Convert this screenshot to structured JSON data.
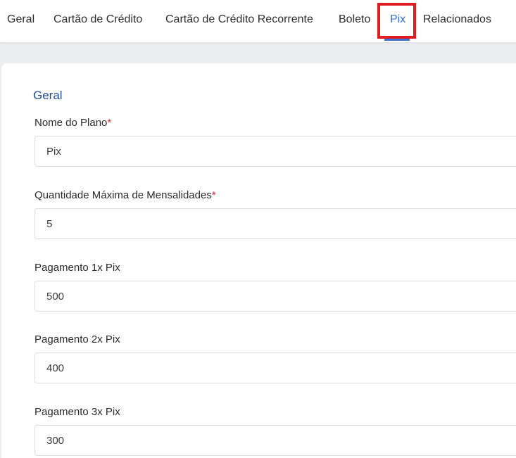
{
  "tabs": [
    {
      "label": "Geral",
      "active": false
    },
    {
      "label": "Cartão de Crédito",
      "active": false
    },
    {
      "label": "Cartão de Crédito Recorrente",
      "active": false
    },
    {
      "label": "Boleto",
      "active": false
    },
    {
      "label": "Pix",
      "active": true
    },
    {
      "label": "Relacionados",
      "active": false
    }
  ],
  "colors": {
    "active_tab": "#2f6fcf",
    "highlight": "#e01b22",
    "section_title": "#1f4e96",
    "required_marker": "#e0282e"
  },
  "form": {
    "section_title": "Geral",
    "required_marker": "*",
    "fields": [
      {
        "label": "Nome do Plano",
        "required": true,
        "value": "Pix"
      },
      {
        "label": "Quantidade Máxima de Mensalidades",
        "required": true,
        "value": "5"
      },
      {
        "label": "Pagamento 1x Pix",
        "required": false,
        "value": "500"
      },
      {
        "label": "Pagamento 2x Pix",
        "required": false,
        "value": "400"
      },
      {
        "label": "Pagamento 3x Pix",
        "required": false,
        "value": "300"
      }
    ]
  }
}
